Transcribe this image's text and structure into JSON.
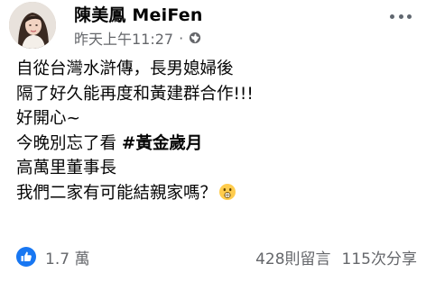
{
  "post": {
    "author": "陳美鳳 MeiFen",
    "timestamp": "昨天上午11:27",
    "separator": "·",
    "privacy_icon": "globe-icon",
    "more_icon": "more-options-icon",
    "lines": [
      {
        "text": "自從台灣水滸傳，長男媳婦後"
      },
      {
        "text": "隔了好久能再度和黃建群合作!!!"
      },
      {
        "text": "好開心~"
      },
      {
        "prefix": "今晚別忘了看 ",
        "hashtag": "#黃金歲月"
      },
      {
        "text": "高萬里董事長"
      },
      {
        "text": "我們二家有可能結親家嗎？",
        "emoji": "shocked-face-emoji"
      }
    ]
  },
  "footer": {
    "like_icon": "like-thumbs-up-icon",
    "reaction_count": "1.7 萬",
    "comments": "428則留言",
    "shares": "115次分享"
  },
  "colors": {
    "text": "#050505",
    "secondary": "#65676b",
    "like_blue": "#1877f2"
  }
}
